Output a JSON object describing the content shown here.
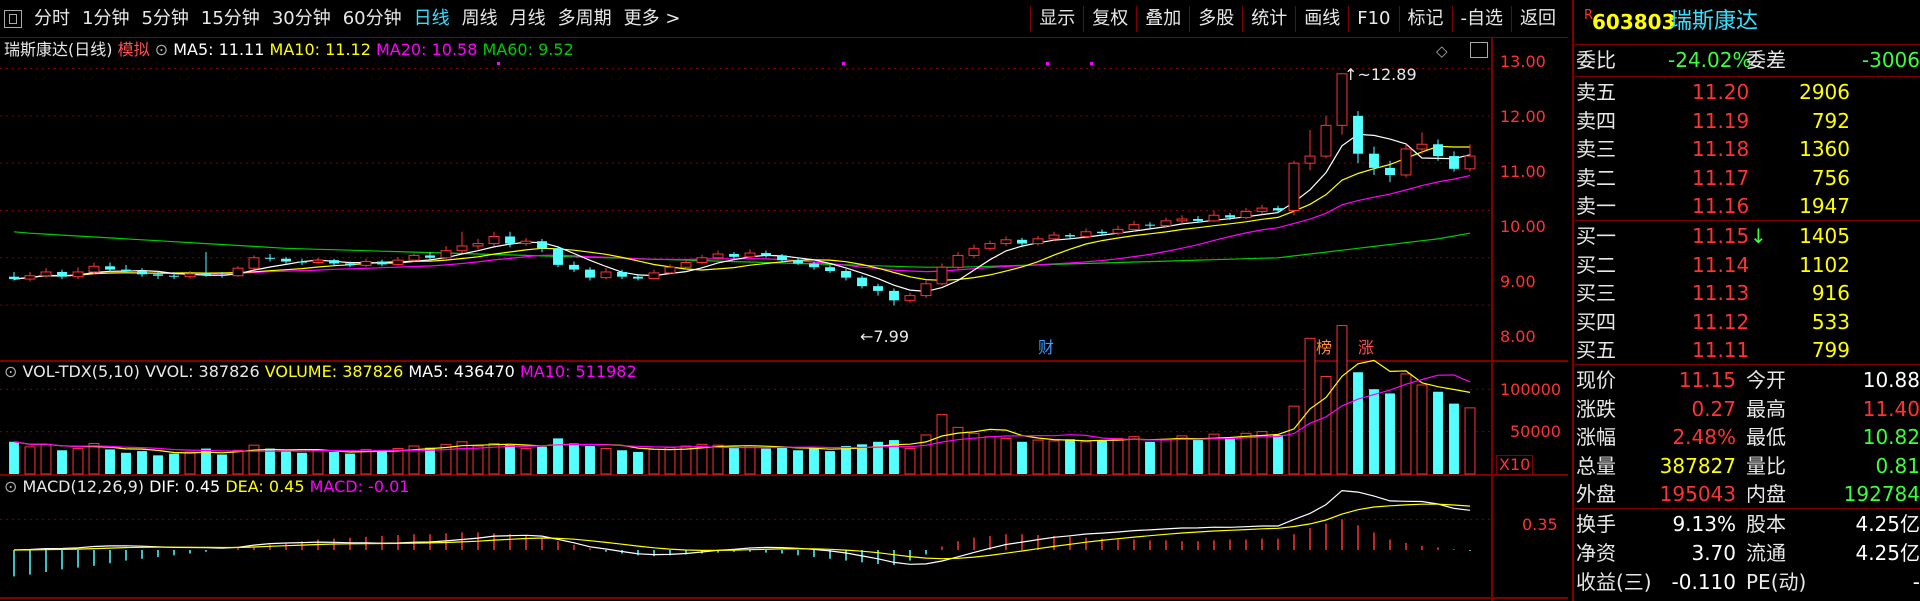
{
  "toolbar": {
    "periods": [
      "分时",
      "1分钟",
      "5分钟",
      "15分钟",
      "30分钟",
      "60分钟",
      "日线",
      "周线",
      "月线",
      "多周期",
      "更多 >"
    ],
    "active_period": "日线",
    "tools": [
      "显示",
      "复权",
      "叠加",
      "多股",
      "统计",
      "画线",
      "F10",
      "标记",
      "-自选",
      "返回"
    ]
  },
  "main_legend": {
    "stock": "瑞斯康达(日线)",
    "mode": "模拟",
    "ma5": "MA5: 11.11",
    "ma10": "MA10: 11.12",
    "ma20": "MA20: 10.58",
    "ma60": "MA60: 9.52"
  },
  "vol_legend": {
    "name": "VOL-TDX(5,10)",
    "vvol": "VVOL: 387826",
    "volume": "VOLUME: 387826",
    "ma5": "MA5: 436470",
    "ma10": "MA10: 511982"
  },
  "macd_legend": {
    "name": "MACD(12,26,9)",
    "dif": "DIF: 0.45",
    "dea": "DEA: 0.45",
    "macd": "MACD: -0.01"
  },
  "price_axis": {
    "labels": [
      "13.00",
      "12.00",
      "11.00",
      "10.00",
      "9.00",
      "8.00"
    ],
    "values": [
      13,
      12,
      11,
      10,
      9,
      8
    ]
  },
  "vol_axis": {
    "labels": [
      "100000",
      "50000"
    ],
    "values": [
      100000,
      50000
    ],
    "unit": "X10"
  },
  "macd_axis": {
    "labels": [
      "0.35"
    ],
    "values": [
      0.35
    ]
  },
  "annotations": {
    "high": "12.89",
    "low": "7.99",
    "badges": [
      "财",
      "榜",
      "涨"
    ]
  },
  "colors": {
    "up": "#ff3232",
    "down": "#54ffff",
    "ma5": "#ffffff",
    "ma10": "#ffff00",
    "ma20": "#ff00ff",
    "ma60": "#00cc00",
    "grid": "#800000"
  },
  "chart_data": {
    "type": "candlestick",
    "price_range": [
      7.6,
      13.35
    ],
    "candles": [
      [
        8.6,
        8.55,
        8.7,
        8.52
      ],
      [
        8.55,
        8.62,
        8.7,
        8.5
      ],
      [
        8.62,
        8.7,
        8.78,
        8.58
      ],
      [
        8.7,
        8.6,
        8.75,
        8.55
      ],
      [
        8.6,
        8.7,
        8.8,
        8.55
      ],
      [
        8.7,
        8.82,
        8.9,
        8.65
      ],
      [
        8.82,
        8.75,
        8.9,
        8.7
      ],
      [
        8.75,
        8.72,
        8.85,
        8.68
      ],
      [
        8.72,
        8.65,
        8.78,
        8.6
      ],
      [
        8.65,
        8.62,
        8.72,
        8.55
      ],
      [
        8.62,
        8.6,
        8.7,
        8.55
      ],
      [
        8.6,
        8.66,
        8.72,
        8.56
      ],
      [
        8.66,
        8.64,
        9.12,
        8.6
      ],
      [
        8.64,
        8.62,
        8.7,
        8.58
      ],
      [
        8.62,
        8.78,
        8.82,
        8.6
      ],
      [
        8.78,
        9.0,
        9.05,
        8.75
      ],
      [
        9.0,
        8.98,
        9.08,
        8.92
      ],
      [
        8.98,
        8.92,
        9.02,
        8.88
      ],
      [
        8.92,
        8.9,
        8.98,
        8.85
      ],
      [
        8.9,
        8.95,
        9.0,
        8.86
      ],
      [
        8.95,
        8.88,
        8.98,
        8.82
      ],
      [
        8.88,
        8.84,
        8.92,
        8.8
      ],
      [
        8.84,
        8.92,
        8.98,
        8.8
      ],
      [
        8.92,
        8.86,
        8.96,
        8.82
      ],
      [
        8.86,
        8.95,
        9.02,
        8.84
      ],
      [
        8.95,
        9.05,
        9.1,
        8.92
      ],
      [
        9.05,
        9.0,
        9.12,
        8.95
      ],
      [
        9.0,
        9.15,
        9.25,
        8.98
      ],
      [
        9.15,
        9.25,
        9.55,
        9.1
      ],
      [
        9.25,
        9.3,
        9.4,
        9.18
      ],
      [
        9.3,
        9.45,
        9.55,
        9.25
      ],
      [
        9.45,
        9.3,
        9.55,
        9.22
      ],
      [
        9.3,
        9.35,
        9.42,
        9.25
      ],
      [
        9.35,
        9.2,
        9.4,
        9.12
      ],
      [
        9.2,
        8.85,
        9.25,
        8.8
      ],
      [
        8.85,
        8.75,
        8.92,
        8.7
      ],
      [
        8.75,
        8.58,
        8.8,
        8.52
      ],
      [
        8.58,
        8.7,
        8.78,
        8.55
      ],
      [
        8.7,
        8.6,
        8.75,
        8.55
      ],
      [
        8.6,
        8.56,
        8.66,
        8.52
      ],
      [
        8.56,
        8.68,
        8.75,
        8.54
      ],
      [
        8.68,
        8.8,
        8.86,
        8.66
      ],
      [
        8.8,
        8.9,
        8.96,
        8.78
      ],
      [
        8.9,
        9.0,
        9.06,
        8.86
      ],
      [
        9.0,
        9.08,
        9.15,
        8.96
      ],
      [
        9.08,
        9.02,
        9.12,
        8.98
      ],
      [
        9.02,
        9.1,
        9.18,
        9.0
      ],
      [
        9.1,
        9.05,
        9.15,
        9.0
      ],
      [
        9.05,
        8.95,
        9.08,
        8.9
      ],
      [
        8.95,
        8.88,
        9.0,
        8.85
      ],
      [
        8.88,
        8.8,
        8.92,
        8.75
      ],
      [
        8.8,
        8.72,
        8.85,
        8.68
      ],
      [
        8.72,
        8.58,
        8.76,
        8.52
      ],
      [
        8.58,
        8.4,
        8.62,
        8.35
      ],
      [
        8.4,
        8.3,
        8.45,
        8.2
      ],
      [
        8.3,
        8.1,
        8.35,
        7.99
      ],
      [
        8.1,
        8.2,
        8.26,
        8.05
      ],
      [
        8.2,
        8.45,
        8.52,
        8.15
      ],
      [
        8.45,
        8.8,
        8.88,
        8.42
      ],
      [
        8.8,
        9.05,
        9.12,
        8.76
      ],
      [
        9.05,
        9.2,
        9.28,
        9.0
      ],
      [
        9.2,
        9.3,
        9.36,
        9.15
      ],
      [
        9.3,
        9.38,
        9.45,
        9.25
      ],
      [
        9.38,
        9.3,
        9.42,
        9.22
      ],
      [
        9.3,
        9.4,
        9.46,
        9.26
      ],
      [
        9.4,
        9.48,
        9.55,
        9.35
      ],
      [
        9.48,
        9.45,
        9.52,
        9.4
      ],
      [
        9.45,
        9.55,
        9.62,
        9.42
      ],
      [
        9.55,
        9.52,
        9.6,
        9.48
      ],
      [
        9.52,
        9.6,
        9.68,
        9.48
      ],
      [
        9.6,
        9.7,
        9.78,
        9.55
      ],
      [
        9.7,
        9.68,
        9.75,
        9.62
      ],
      [
        9.68,
        9.78,
        9.85,
        9.65
      ],
      [
        9.78,
        9.82,
        9.9,
        9.72
      ],
      [
        9.82,
        9.78,
        9.88,
        9.74
      ],
      [
        9.78,
        9.9,
        10.0,
        9.76
      ],
      [
        9.9,
        9.85,
        9.95,
        9.8
      ],
      [
        9.85,
        9.98,
        10.05,
        9.82
      ],
      [
        9.98,
        10.05,
        10.12,
        9.92
      ],
      [
        10.05,
        10.0,
        10.1,
        9.95
      ],
      [
        10.0,
        11.0,
        11.05,
        9.9
      ],
      [
        11.0,
        11.15,
        11.7,
        10.85
      ],
      [
        11.15,
        11.8,
        12.0,
        11.1
      ],
      [
        11.8,
        12.89,
        12.89,
        11.6
      ],
      [
        12.0,
        11.2,
        12.1,
        11.0
      ],
      [
        11.2,
        10.9,
        11.35,
        10.75
      ],
      [
        10.9,
        10.75,
        11.05,
        10.6
      ],
      [
        10.75,
        11.3,
        11.4,
        10.7
      ],
      [
        11.3,
        11.4,
        11.65,
        11.2
      ],
      [
        11.4,
        11.15,
        11.5,
        11.05
      ],
      [
        11.15,
        10.88,
        11.25,
        10.82
      ],
      [
        10.88,
        11.15,
        11.4,
        10.82
      ]
    ],
    "volume": [
      38,
      32,
      35,
      28,
      30,
      36,
      29,
      25,
      27,
      22,
      24,
      26,
      30,
      23,
      28,
      34,
      30,
      27,
      25,
      28,
      26,
      24,
      29,
      27,
      30,
      33,
      31,
      35,
      38,
      33,
      36,
      34,
      30,
      32,
      42,
      36,
      33,
      30,
      28,
      26,
      29,
      31,
      33,
      35,
      34,
      32,
      33,
      30,
      31,
      28,
      30,
      27,
      33,
      35,
      38,
      40,
      30,
      46,
      70,
      55,
      48,
      44,
      42,
      38,
      40,
      39,
      41,
      38,
      40,
      42,
      44,
      38,
      41,
      45,
      40,
      47,
      42,
      48,
      50,
      46,
      80,
      160,
      115,
      175,
      120,
      100,
      95,
      118,
      105,
      97,
      83,
      78
    ],
    "vol_range": [
      0,
      125000
    ],
    "ma60": [
      9.55,
      9.52,
      9.5,
      9.48,
      9.46,
      9.44,
      9.42,
      9.4,
      9.38,
      9.36,
      9.34,
      9.32,
      9.3,
      9.28,
      9.26,
      9.24,
      9.22,
      9.2,
      9.19,
      9.18,
      9.17,
      9.16,
      9.15,
      9.14,
      9.13,
      9.12,
      9.11,
      9.1,
      9.09,
      9.08,
      9.07,
      9.06,
      9.05,
      9.04,
      9.03,
      9.02,
      9.01,
      9.0,
      8.99,
      8.98,
      8.97,
      8.96,
      8.95,
      8.94,
      8.93,
      8.92,
      8.91,
      8.9,
      8.89,
      8.88,
      8.87,
      8.86,
      8.85,
      8.84,
      8.83,
      8.82,
      8.81,
      8.8,
      8.8,
      8.8,
      8.81,
      8.82,
      8.83,
      8.84,
      8.85,
      8.86,
      8.87,
      8.88,
      8.89,
      8.9,
      8.91,
      8.92,
      8.93,
      8.94,
      8.95,
      8.96,
      8.97,
      8.98,
      8.99,
      9.0,
      9.04,
      9.08,
      9.12,
      9.16,
      9.2,
      9.24,
      9.28,
      9.32,
      9.36,
      9.4,
      9.46,
      9.52
    ],
    "macd_range": [
      -0.5,
      0.75
    ],
    "macd_hist": [
      -0.3,
      -0.28,
      -0.25,
      -0.22,
      -0.2,
      -0.18,
      -0.15,
      -0.12,
      -0.1,
      -0.08,
      -0.06,
      -0.04,
      -0.02,
      0.0,
      0.02,
      0.04,
      0.06,
      0.08,
      0.1,
      0.12,
      0.13,
      0.14,
      0.15,
      0.16,
      0.17,
      0.18,
      0.18,
      0.19,
      0.2,
      0.2,
      0.19,
      0.18,
      0.16,
      0.14,
      0.1,
      0.06,
      0.02,
      -0.02,
      -0.04,
      -0.06,
      -0.07,
      -0.06,
      -0.05,
      -0.04,
      -0.03,
      -0.02,
      -0.02,
      -0.03,
      -0.04,
      -0.06,
      -0.08,
      -0.1,
      -0.12,
      -0.14,
      -0.16,
      -0.17,
      -0.12,
      -0.05,
      0.04,
      0.1,
      0.14,
      0.16,
      0.18,
      0.18,
      0.17,
      0.16,
      0.15,
      0.14,
      0.13,
      0.12,
      0.12,
      0.11,
      0.11,
      0.1,
      0.1,
      0.11,
      0.12,
      0.12,
      0.13,
      0.13,
      0.18,
      0.25,
      0.3,
      0.35,
      0.28,
      0.2,
      0.12,
      0.08,
      0.05,
      0.03,
      0.01,
      -0.01
    ]
  },
  "quote": {
    "code": "603803",
    "name": "瑞斯康达",
    "r_mark": "R",
    "weibi_label": "委比",
    "weibi": "-24.02%",
    "weicha_label": "委差",
    "weicha": "-3006",
    "asks": [
      {
        "label": "卖五",
        "price": "11.20",
        "vol": "2906"
      },
      {
        "label": "卖四",
        "price": "11.19",
        "vol": "792"
      },
      {
        "label": "卖三",
        "price": "11.18",
        "vol": "1360"
      },
      {
        "label": "卖二",
        "price": "11.17",
        "vol": "756"
      },
      {
        "label": "卖一",
        "price": "11.16",
        "vol": "1947"
      }
    ],
    "bids": [
      {
        "label": "买一",
        "price": "11.15",
        "vol": "1405",
        "mark": "↓"
      },
      {
        "label": "买二",
        "price": "11.14",
        "vol": "1102",
        "mark": ""
      },
      {
        "label": "买三",
        "price": "11.13",
        "vol": "916",
        "mark": ""
      },
      {
        "label": "买四",
        "price": "11.12",
        "vol": "533",
        "mark": ""
      },
      {
        "label": "买五",
        "price": "11.11",
        "vol": "799",
        "mark": ""
      }
    ],
    "stats": [
      {
        "l1": "现价",
        "v1": "11.15",
        "c1": "#ff3232",
        "l2": "今开",
        "v2": "10.88",
        "c2": "#ffffff"
      },
      {
        "l1": "涨跌",
        "v1": "0.27",
        "c1": "#ff3232",
        "l2": "最高",
        "v2": "11.40",
        "c2": "#ff3232"
      },
      {
        "l1": "涨幅",
        "v1": "2.48%",
        "c1": "#ff3232",
        "l2": "最低",
        "v2": "10.82",
        "c2": "#3cff3c"
      },
      {
        "l1": "总量",
        "v1": "387827",
        "c1": "#ffff00",
        "l2": "量比",
        "v2": "0.81",
        "c2": "#3cff3c"
      },
      {
        "l1": "外盘",
        "v1": "195043",
        "c1": "#ff3232",
        "l2": "内盘",
        "v2": "192784",
        "c2": "#3cff3c"
      }
    ],
    "fund": [
      {
        "l1": "换手",
        "v1": "9.13%",
        "l2": "股本",
        "v2": "4.25亿"
      },
      {
        "l1": "净资",
        "v1": "3.70",
        "l2": "流通",
        "v2": "4.25亿"
      },
      {
        "l1": "收益(三)",
        "v1": "-0.110",
        "l2": "PE(动)",
        "v2": "-"
      }
    ]
  }
}
